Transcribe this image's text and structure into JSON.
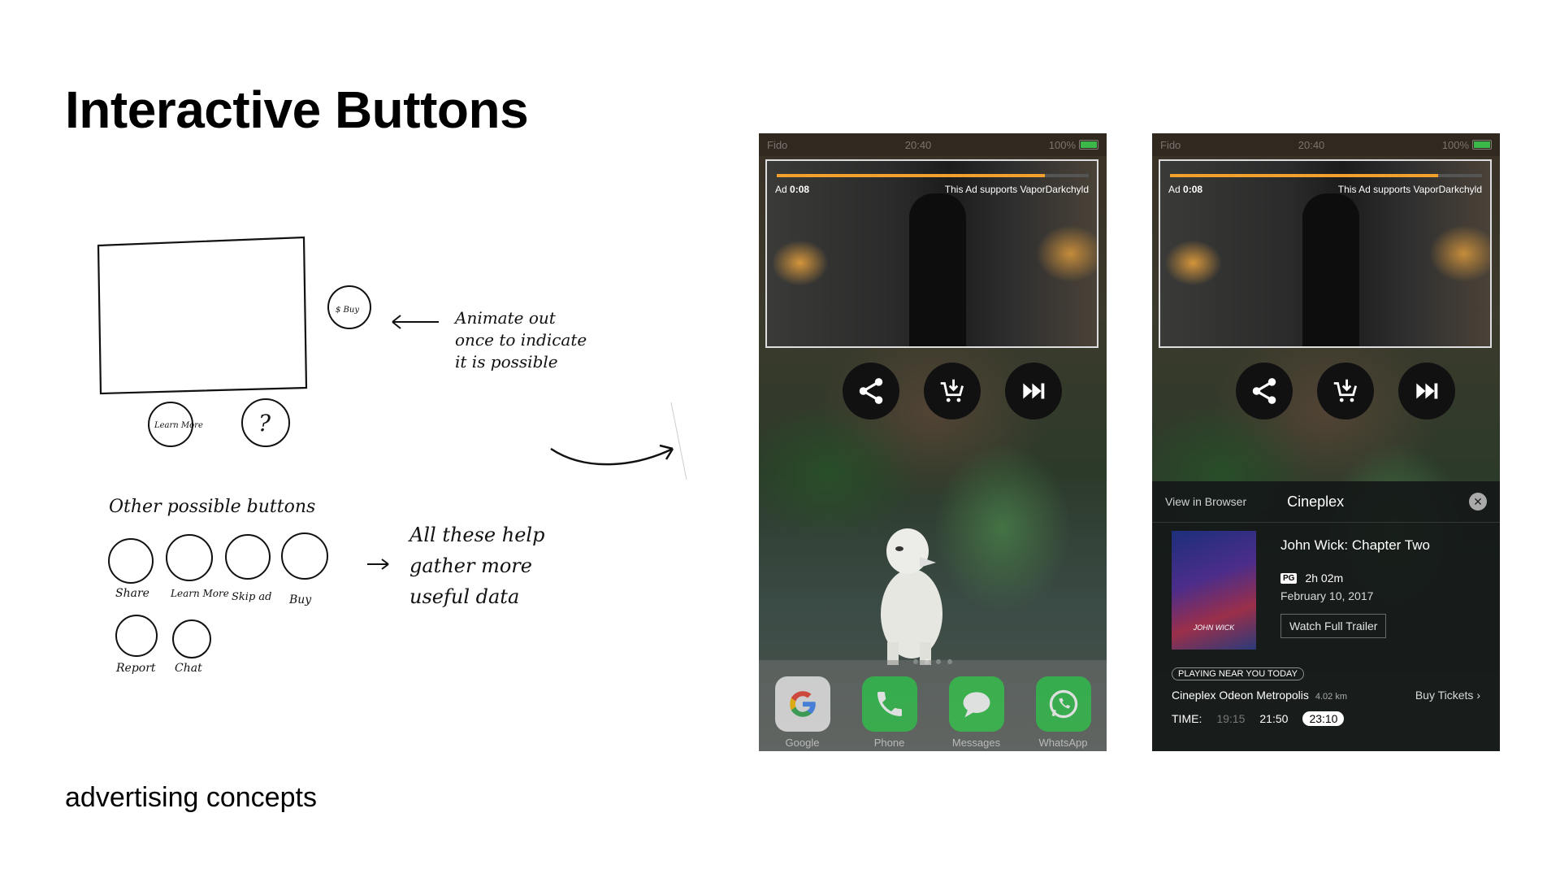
{
  "slide": {
    "title": "Interactive Buttons",
    "subtitle": "advertising concepts"
  },
  "sketch": {
    "buy_label": "$ Buy",
    "learn_more_label": "Learn More",
    "question_label": "?",
    "note_line1": "Animate out",
    "note_line2": "once to indicate",
    "note_line3": "it is possible",
    "other_heading": "Other possible buttons",
    "buttons": [
      "Share",
      "Learn More",
      "Skip ad",
      "Buy",
      "Report",
      "Chat"
    ],
    "help_line1": "All these help",
    "help_line2": "gather more",
    "help_line3": "useful data"
  },
  "phone": {
    "carrier": "Fido",
    "time": "20:40",
    "battery": "100%"
  },
  "ad": {
    "label": "Ad",
    "countdown": "0:08",
    "support_text": "This Ad supports VaporDarkchyld",
    "progress": 0.86
  },
  "actions": [
    {
      "name": "share",
      "icon": "share-icon"
    },
    {
      "name": "buy",
      "icon": "cart-download-icon"
    },
    {
      "name": "skip",
      "icon": "skip-forward-icon"
    }
  ],
  "dock": [
    {
      "label": "Google",
      "icon": "google-icon",
      "color": "#e8e8e8"
    },
    {
      "label": "Phone",
      "icon": "phone-icon",
      "color": "#2fbf4a"
    },
    {
      "label": "Messages",
      "icon": "messages-icon",
      "color": "#34c24a"
    },
    {
      "label": "WhatsApp",
      "icon": "whatsapp-icon",
      "color": "#2fbf4a"
    }
  ],
  "panel": {
    "view_in_browser": "View in Browser",
    "brand": "Cineplex",
    "movie_title": "John Wick: Chapter Two",
    "rating": "PG",
    "duration": "2h 02m",
    "release_date": "February 10, 2017",
    "trailer_button": "Watch Full Trailer",
    "poster_text": "JOHN WICK",
    "playing_near": "PLAYING NEAR YOU TODAY",
    "theater": "Cineplex Odeon Metropolis",
    "distance": "4.02 km",
    "buy_tickets": "Buy Tickets",
    "time_label": "TIME:",
    "times": [
      "19:15",
      "21:50",
      "23:10"
    ]
  }
}
